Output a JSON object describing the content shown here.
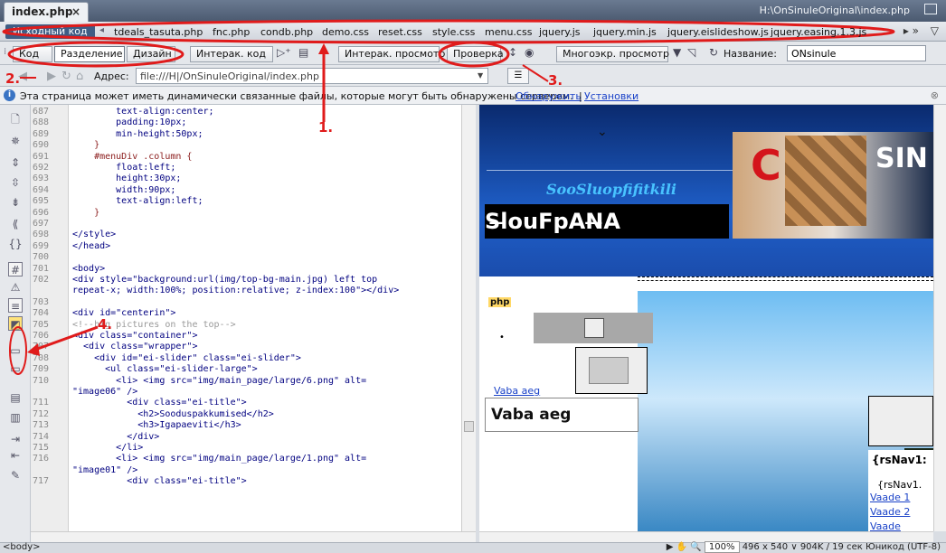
{
  "window": {
    "tab_label": "index.php",
    "tab_close": "×",
    "file_path": "H:\\OnSinuleOriginal\\index.php"
  },
  "related_files": {
    "source_label": "Исходный код",
    "files": [
      "tdeals_tasuta.php",
      "fnc.php",
      "condb.php",
      "demo.css",
      "reset.css",
      "style.css",
      "menu.css",
      "jquery.js",
      "jquery.min.js",
      "jquery.eislideshow.js",
      "jquery.easing.1.3.js"
    ],
    "more": "▸ »",
    "filter": "▽"
  },
  "toolbar": {
    "code": "Код",
    "split": "Разделение",
    "design": "Дизайн",
    "live_code": "Интерак. код",
    "live_view": "Интерак. просмотр",
    "check": "Проверка",
    "multiscreen": "Многоэкр. просмотр",
    "title_label": "Название:",
    "title_value": "ONsinule"
  },
  "address": {
    "label": "Адрес:",
    "value": "file:///H|/OnSinuleOriginal/index.php"
  },
  "infobar": {
    "text": "Эта страница может иметь динамически связанные файлы, которые могут быть обнаружены сервером.",
    "link_discover": "Обнаружить",
    "separator": "|",
    "link_settings": "Установки"
  },
  "code": {
    "lines": [
      {
        "n": "687",
        "t": "        text-align:center;",
        "k": "prop"
      },
      {
        "n": "688",
        "t": "        padding:10px;",
        "k": "prop"
      },
      {
        "n": "689",
        "t": "        min-height:50px;",
        "k": "prop"
      },
      {
        "n": "690",
        "t": "    }",
        "k": "sel"
      },
      {
        "n": "691",
        "t": "    #menuDiv .column {",
        "k": "sel"
      },
      {
        "n": "692",
        "t": "        float:left;",
        "k": "prop"
      },
      {
        "n": "693",
        "t": "        height:30px;",
        "k": "prop"
      },
      {
        "n": "694",
        "t": "        width:90px;",
        "k": "prop"
      },
      {
        "n": "695",
        "t": "        text-align:left;",
        "k": "prop"
      },
      {
        "n": "696",
        "t": "    }",
        "k": "sel"
      },
      {
        "n": "697",
        "t": "",
        "k": "prop"
      },
      {
        "n": "698",
        "t": "</style>",
        "k": "prop"
      },
      {
        "n": "699",
        "t": "</head>",
        "k": "prop"
      },
      {
        "n": "700",
        "t": "",
        "k": "prop"
      },
      {
        "n": "701",
        "t": "<body>",
        "k": "prop"
      },
      {
        "n": "702",
        "t": "<div style=\"background:url(img/top-bg-main.jpg) left top",
        "k": "prop"
      },
      {
        "n": "",
        "t": "repeat-x; width:100%; position:relative; z-index:100\"></div>",
        "k": "prop"
      },
      {
        "n": "703",
        "t": "",
        "k": "prop"
      },
      {
        "n": "704",
        "t": "<div id=\"centerin\">",
        "k": "prop"
      },
      {
        "n": "705",
        "t": "<!--big pictures on the top-->",
        "k": "cmt"
      },
      {
        "n": "706",
        "t": "<div class=\"container\">",
        "k": "prop"
      },
      {
        "n": "707",
        "t": "  <div class=\"wrapper\">",
        "k": "prop"
      },
      {
        "n": "708",
        "t": "    <div id=\"ei-slider\" class=\"ei-slider\">",
        "k": "prop"
      },
      {
        "n": "709",
        "t": "      <ul class=\"ei-slider-large\">",
        "k": "prop"
      },
      {
        "n": "710",
        "t": "        <li> <img src=\"img/main_page/large/6.png\" alt=",
        "k": "prop"
      },
      {
        "n": "",
        "t": "\"image06\" />",
        "k": "prop"
      },
      {
        "n": "711",
        "t": "          <div class=\"ei-title\">",
        "k": "prop"
      },
      {
        "n": "712",
        "t": "            <h2>Sooduspakkumised</h2>",
        "k": "prop"
      },
      {
        "n": "713",
        "t": "            <h3>Igapaeviti</h3>",
        "k": "prop"
      },
      {
        "n": "714",
        "t": "          </div>",
        "k": "prop"
      },
      {
        "n": "715",
        "t": "        </li>",
        "k": "prop"
      },
      {
        "n": "716",
        "t": "        <li> <img src=\"img/main_page/large/1.png\" alt=",
        "k": "prop"
      },
      {
        "n": "",
        "t": "\"image01\" />",
        "k": "prop"
      },
      {
        "n": "717",
        "t": "          <div class=\"ei-title\">",
        "k": "prop"
      }
    ]
  },
  "design": {
    "slogan": "SooSluopfifitkili",
    "dark_heading": "Sl̶ouFpAN̶A",
    "php_tag": "php",
    "dot": "•",
    "vaba_link": "Vaba aeg",
    "vaba_box": "Vaba aeg",
    "nav_bold": "{rsNav1:",
    "nav_plain": "{rsNav1.",
    "nav_links": [
      "Vaade 1",
      "Vaade 2",
      "Vaade"
    ],
    "brand_letter": "C",
    "brand_tail": "SIN"
  },
  "status": {
    "tag": "<body>",
    "zoom": "100%",
    "info": "496 x 540 ∨ 904K / 19 сек Юникод (UTF-8)"
  },
  "annotations": [
    "1.",
    "2.",
    "3.",
    "4."
  ],
  "colors": {
    "annotation": "#e01b1b",
    "design_bg": "#1a4aa8",
    "link": "#1a42c8"
  }
}
